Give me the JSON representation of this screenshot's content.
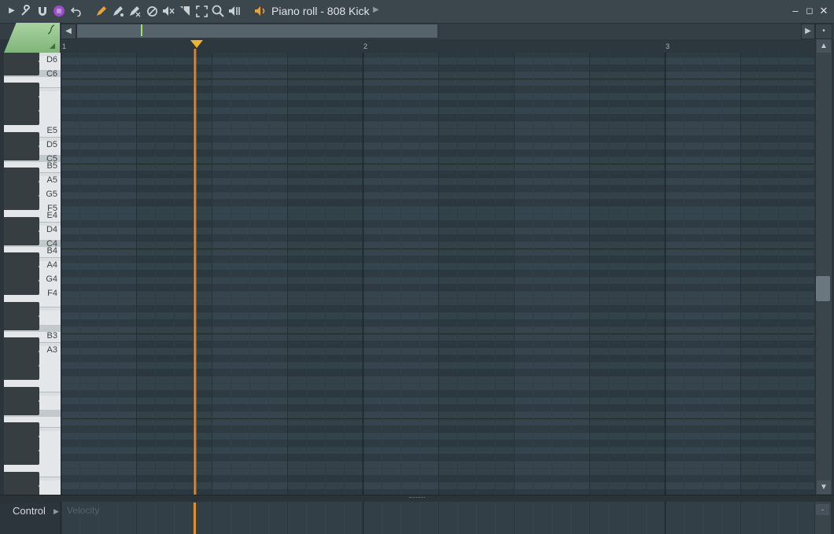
{
  "window": {
    "title": "Piano roll - 808 Kick",
    "minimize_icon": "minimize-icon",
    "maximize_icon": "maximize-icon",
    "close_icon": "close-icon"
  },
  "toolbar": {
    "icons": [
      "menu-arrow-icon",
      "wrench-icon",
      "magnet-icon",
      "snap-icon",
      "undo-icon",
      "pencil-icon",
      "paint-icon",
      "delete-brush-icon",
      "mute-icon",
      "speaker-mute-icon",
      "slice-icon",
      "select-icon",
      "zoom-icon",
      "playback-icon",
      "speaker-icon"
    ]
  },
  "ruler": {
    "bars": [
      "1",
      "2",
      "3"
    ]
  },
  "keyboard": {
    "labels": [
      "D6",
      "C6",
      "B5",
      "A5",
      "G5",
      "F5",
      "E5",
      "D5",
      "C5",
      "B4",
      "A4",
      "G4",
      "F4",
      "E4",
      "D4",
      "C4",
      "B3",
      "A3"
    ]
  },
  "event_editor": {
    "control_label": "Control",
    "velocity_label": "Velocity"
  },
  "colors": {
    "playhead": "#f0a040",
    "tool_tab": "#8fc487",
    "grid_bg": "#34434b"
  }
}
